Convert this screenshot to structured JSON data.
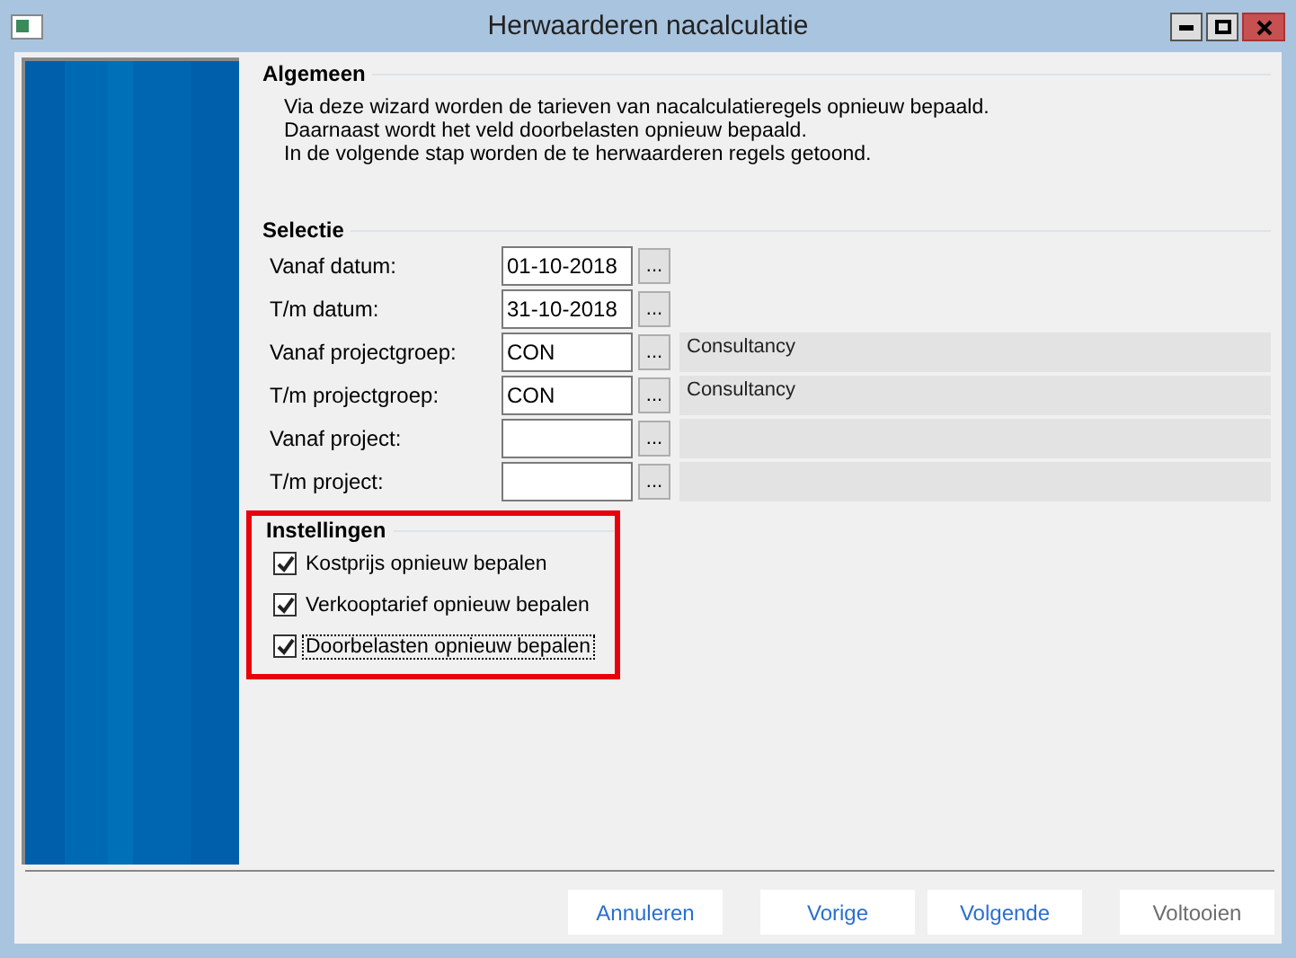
{
  "window": {
    "title": "Herwaarderen nacalculatie"
  },
  "general": {
    "heading": "Algemeen",
    "lines": [
      "Via deze wizard worden de tarieven van nacalculatieregels opnieuw bepaald.",
      "Daarnaast wordt het veld doorbelasten opnieuw bepaald.",
      "In de volgende stap worden de te herwaarderen regels getoond."
    ]
  },
  "selection": {
    "heading": "Selectie",
    "rows": [
      {
        "label": "Vanaf datum:",
        "value": "01-10-2018",
        "browse": "...",
        "has_description": false
      },
      {
        "label": "T/m datum:",
        "value": "31-10-2018",
        "browse": "...",
        "has_description": false
      },
      {
        "label": "Vanaf projectgroep:",
        "value": "CON",
        "browse": "...",
        "has_description": true,
        "description": "Consultancy"
      },
      {
        "label": "T/m projectgroep:",
        "value": "CON",
        "browse": "...",
        "has_description": true,
        "description": "Consultancy"
      },
      {
        "label": "Vanaf project:",
        "browse": "...",
        "has_description": true
      },
      {
        "label": "T/m project:",
        "browse": "...",
        "has_description": true
      }
    ]
  },
  "settings": {
    "heading": "Instellingen",
    "highlighted": true,
    "checks": [
      {
        "label": "Kostprijs opnieuw bepalen",
        "checked": true,
        "focused": false
      },
      {
        "label": "Verkooptarief opnieuw bepalen",
        "checked": true,
        "focused": false
      },
      {
        "label": "Doorbelasten opnieuw bepalen",
        "checked": true,
        "focused": true
      }
    ]
  },
  "buttons": [
    {
      "label": "Annuleren",
      "disabled": false
    },
    {
      "label": "Vorige",
      "disabled": false
    },
    {
      "label": "Volgende",
      "disabled": false
    },
    {
      "label": "Voltooien",
      "disabled": true
    }
  ]
}
